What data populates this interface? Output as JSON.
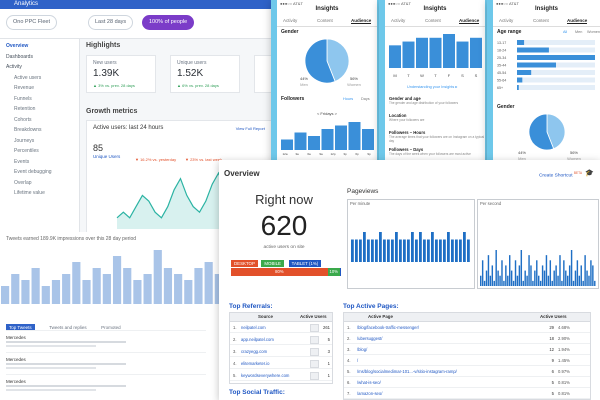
{
  "analytics": {
    "app_name": "Analytics",
    "property": "Ono PPC Fleet",
    "date_range": "Last 28 days",
    "segment": "100% of people",
    "nav": [
      {
        "label": "Overview",
        "selected": true
      },
      {
        "label": "Dashboards"
      },
      {
        "label": "Activity"
      },
      {
        "label": "Active users",
        "sub": true
      },
      {
        "label": "Revenue",
        "sub": true
      },
      {
        "label": "Funnels",
        "sub": true
      },
      {
        "label": "Retention",
        "sub": true
      },
      {
        "label": "Cohorts",
        "sub": true
      },
      {
        "label": "Breakdowns",
        "sub": true
      },
      {
        "label": "Journeys",
        "sub": true
      },
      {
        "label": "Percentiles",
        "sub": true
      },
      {
        "label": "Events",
        "sub": true
      },
      {
        "label": "Event debugging",
        "sub": true
      },
      {
        "label": "Overlap",
        "sub": true
      },
      {
        "label": "Lifetime value",
        "sub": true
      }
    ],
    "highlights_title": "Highlights",
    "cards": [
      {
        "label": "New users",
        "value": "1.39K",
        "delta": "▲ 3% vs. prev. 28 days"
      },
      {
        "label": "Unique users",
        "value": "1.52K",
        "delta": "▲ 6% vs. prev. 28 days"
      }
    ],
    "growth_title": "Growth metrics",
    "realtime": {
      "label": "Active users: last 24 hours",
      "link": "View Full Report",
      "value": "85",
      "sub_label": "Unique Users",
      "legend": [
        "▼ 16.2% vs. yesterday",
        "▼ 23% vs. last week"
      ]
    },
    "banner": "Tweets earned 189.9K impressions over this 28 day period",
    "tabs": [
      "Top Tweets",
      "Tweets and replies",
      "Promoted"
    ],
    "rows": [
      {
        "label": "Mercedes"
      },
      {
        "label": "Mercedes"
      },
      {
        "label": "Mercedes"
      }
    ],
    "bar_chart": {
      "type": "bar",
      "values": [
        3,
        5,
        4,
        6,
        3,
        4,
        5,
        7,
        4,
        6,
        5,
        8,
        6,
        4,
        5,
        9,
        6,
        5,
        4,
        6,
        7,
        5,
        4,
        6,
        5,
        8,
        7,
        6
      ]
    },
    "line_chart": {
      "type": "line",
      "values": [
        2,
        3,
        2,
        4,
        6,
        5,
        3,
        2,
        4,
        7,
        9,
        6,
        4,
        3,
        5,
        8,
        10,
        7,
        5,
        4,
        3,
        5,
        6,
        4
      ]
    }
  },
  "phones": [
    {
      "status": "●●●○○ AT&T",
      "title": "Insights",
      "tabs": [
        "Activity",
        "Content",
        "Audience"
      ],
      "active_tab": 2,
      "section1": "Gender",
      "pie": [
        {
          "label": "Men",
          "pct": "44%",
          "value": 44
        },
        {
          "label": "Women",
          "pct": "56%",
          "value": 56
        }
      ],
      "section2": "Followers",
      "links": [
        "Hours",
        "Days"
      ],
      "day_nav": "< Fridays >",
      "bars": [
        3,
        5,
        4,
        6,
        7,
        8,
        6
      ],
      "hour_labels": [
        "12a",
        "3a",
        "6a",
        "9a",
        "12p",
        "3p",
        "6p",
        "9p"
      ]
    },
    {
      "status": "●●●○○ AT&T",
      "title": "Insights",
      "tabs": [
        "Activity",
        "Content",
        "Audience"
      ],
      "active_tab": 2,
      "bars": [
        6,
        7,
        8,
        8,
        9,
        7,
        8
      ],
      "day_labels": [
        "M",
        "T",
        "W",
        "T",
        "F",
        "S",
        "S"
      ],
      "link": "Understanding your Insights ▸",
      "items": [
        {
          "h": "Gender and age",
          "t": "The gender and age distribution of your followers"
        },
        {
          "h": "Location",
          "t": "Where your followers are"
        },
        {
          "h": "Followers – Hours",
          "t": "The average times that your followers are on Instagram on a typical day"
        },
        {
          "h": "Followers – Days",
          "t": "The days of the week when your followers are most active"
        }
      ]
    },
    {
      "status": "●●●○○ AT&T",
      "title": "Insights",
      "tabs": [
        "Activity",
        "Content",
        "Audience"
      ],
      "active_tab": 2,
      "section1": "Age range",
      "links": [
        "All",
        "Men",
        "Women"
      ],
      "ages": [
        {
          "label": "13-17",
          "value": 4
        },
        {
          "label": "18-24",
          "value": 18
        },
        {
          "label": "25-34",
          "value": 44
        },
        {
          "label": "35-44",
          "value": 22
        },
        {
          "label": "45-54",
          "value": 8
        },
        {
          "label": "55-64",
          "value": 3
        },
        {
          "label": "65+",
          "value": 1
        }
      ],
      "section2": "Gender",
      "pie": [
        {
          "label": "Men",
          "pct": "44%",
          "value": 44
        },
        {
          "label": "Women",
          "pct": "56%",
          "value": 56
        }
      ]
    }
  ],
  "overview": {
    "title": "Overview",
    "create_shortcut": "Create Shortcut",
    "beta": "BETA",
    "right_now_label": "Right now",
    "active_users": "620",
    "active_users_caption": "active users on site",
    "devices": [
      {
        "label": "DESKTOP",
        "color": "#e2502a",
        "share": 80,
        "text": "80%"
      },
      {
        "label": "MOBILE",
        "color": "#3aa94b",
        "share": 10,
        "text": "10%"
      },
      {
        "label": "TABLET (1%)",
        "color": "#1f57c3",
        "share": 1,
        "text": ""
      }
    ],
    "pageviews_title": "Pageviews",
    "per_minute": "Per minute",
    "per_second": "Per second",
    "per_minute_values": [
      3,
      3,
      3,
      4,
      3,
      3,
      3,
      4,
      3,
      3,
      3,
      4,
      3,
      3,
      3,
      4,
      3,
      4,
      3,
      3,
      4,
      3,
      3,
      3,
      4,
      3,
      3,
      3,
      4,
      3
    ],
    "per_second_values": [
      2,
      5,
      1,
      3,
      6,
      2,
      4,
      1,
      7,
      3,
      2,
      5,
      1,
      4,
      2,
      6,
      3,
      1,
      5,
      2,
      4,
      7,
      1,
      3,
      2,
      6,
      4,
      1,
      3,
      5,
      2,
      1,
      4,
      3,
      6,
      2,
      5,
      1,
      3,
      4,
      2,
      6,
      1,
      5,
      3,
      2,
      4,
      7,
      1,
      3,
      5,
      2,
      4,
      1,
      6,
      3,
      2,
      5,
      4,
      1
    ],
    "referrals_title": "Top Referrals:",
    "referrals_head": [
      "Source",
      "Active Users"
    ],
    "referrals": [
      {
        "source": "neilpatel.com",
        "users": "261"
      },
      {
        "source": "app.neilpatel.com",
        "users": "5"
      },
      {
        "source": "crazyegg.com",
        "users": "3"
      },
      {
        "source": "elitemarketer.io",
        "users": "1"
      },
      {
        "source": "keywordseverywhere.com",
        "users": "1"
      }
    ],
    "social_title": "Top Social Traffic:",
    "pages_title": "Top Active Pages:",
    "pages_head": [
      "Active Page",
      "Active Users"
    ],
    "pages": [
      {
        "page": "/blog/facebook-traffic-messenger/",
        "users": "29",
        "pct": "4.68%"
      },
      {
        "page": "/ubersuggest/",
        "users": "18",
        "pct": "2.90%"
      },
      {
        "page": "/blog/",
        "users": "12",
        "pct": "1.94%"
      },
      {
        "page": "/",
        "users": "9",
        "pct": "1.45%"
      },
      {
        "page": "/ms/blog/socialmedimar-101...-v/sitio-instagram-ramp/",
        "users": "6",
        "pct": "0.97%"
      },
      {
        "page": "/what-is-seo/",
        "users": "5",
        "pct": "0.81%"
      },
      {
        "page": "/amazon-seo/",
        "users": "5",
        "pct": "0.81%"
      }
    ]
  }
}
